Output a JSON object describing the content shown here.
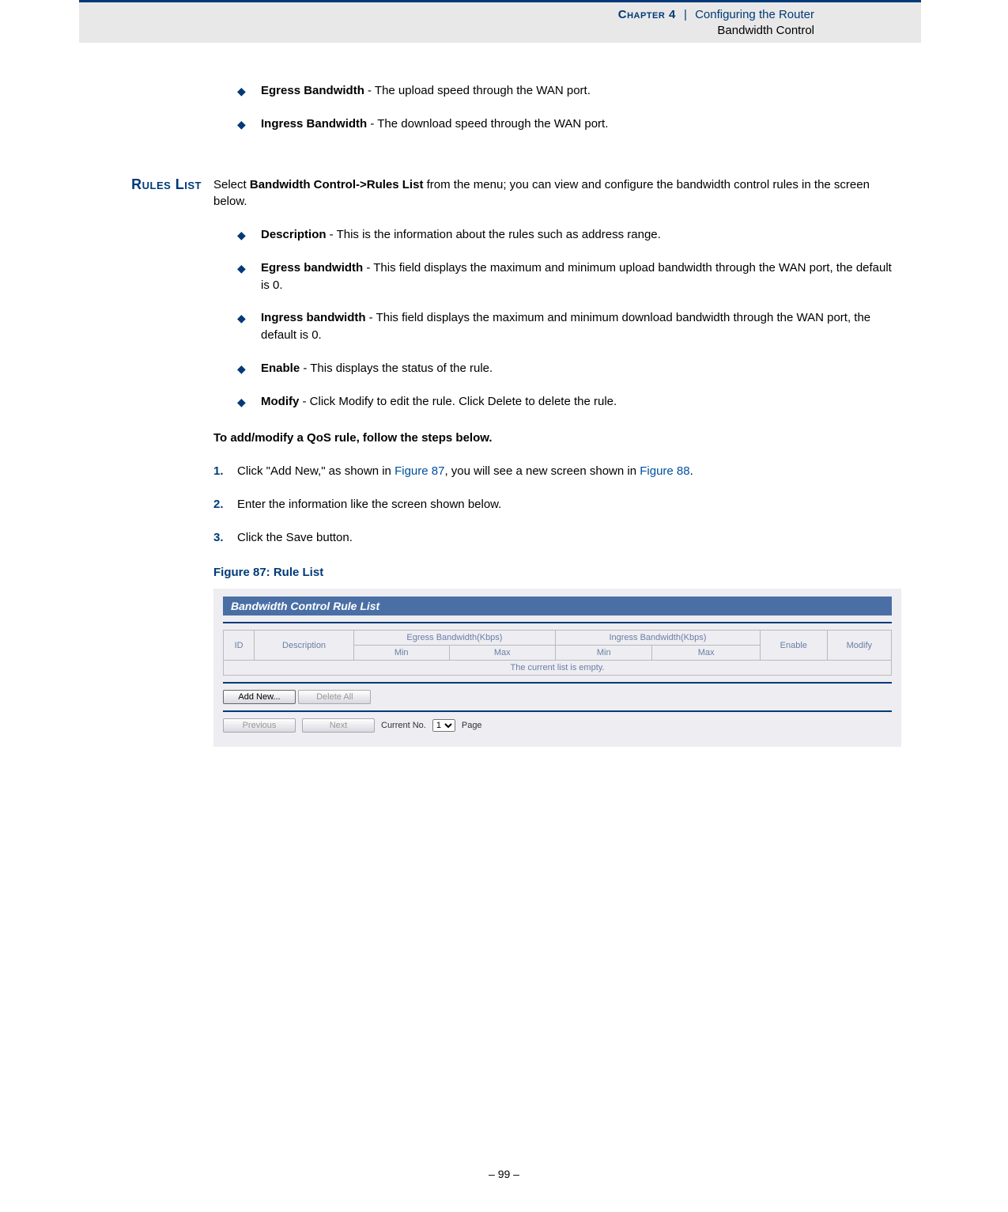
{
  "header": {
    "chapter_label": "Chapter 4",
    "separator": "|",
    "chapter_title": "Configuring the Router",
    "sub_title": "Bandwidth Control"
  },
  "intro_bullets": [
    {
      "term": "Egress Bandwidth",
      "desc": " - The upload speed through the WAN port."
    },
    {
      "term": "Ingress Bandwidth",
      "desc": " - The download speed through the WAN port."
    }
  ],
  "rules_list": {
    "side_heading": "Rules List",
    "lead_pre": "Select ",
    "lead_bold": "Bandwidth Control->Rules List",
    "lead_post": " from the menu; you can view and configure the bandwidth control rules in the screen below.",
    "bullets": [
      {
        "term": "Description",
        "desc": " - This is the information about the rules such as address range."
      },
      {
        "term": "Egress bandwidth",
        "desc": " - This field displays the maximum and minimum upload bandwidth through the WAN port, the default is 0."
      },
      {
        "term": "Ingress bandwidth",
        "desc": " - This field displays the maximum and minimum download bandwidth through the WAN port, the default is 0."
      },
      {
        "term": "Enable",
        "desc": " - This displays the status of the rule."
      },
      {
        "term": "Modify",
        "desc": " - Click Modify to edit the rule. Click Delete to delete the rule."
      }
    ],
    "instruction": "To add/modify a QoS rule, follow the steps below.",
    "steps": {
      "s1_pre": "Click \"Add New,\" as shown in ",
      "s1_link1": "Figure 87",
      "s1_mid": ", you will see a new screen shown in ",
      "s1_link2": "Figure 88",
      "s1_post": ".",
      "s2": "Enter the information like the screen shown below.",
      "s3": "Click the Save button."
    }
  },
  "figure": {
    "caption": "Figure 87:  Rule List",
    "panel_title": "Bandwidth Control Rule List",
    "cols": {
      "id": "ID",
      "desc": "Description",
      "egress": "Egress Bandwidth(Kbps)",
      "ingress": "Ingress Bandwidth(Kbps)",
      "min": "Min",
      "max": "Max",
      "enable": "Enable",
      "modify": "Modify"
    },
    "empty_msg": "The current list is empty.",
    "buttons": {
      "add_new": "Add New...",
      "delete_all": "Delete All",
      "previous": "Previous",
      "next": "Next"
    },
    "pager": {
      "label_pre": "Current No.",
      "value": "1",
      "label_post": "Page"
    }
  },
  "footer": "–  99  –"
}
